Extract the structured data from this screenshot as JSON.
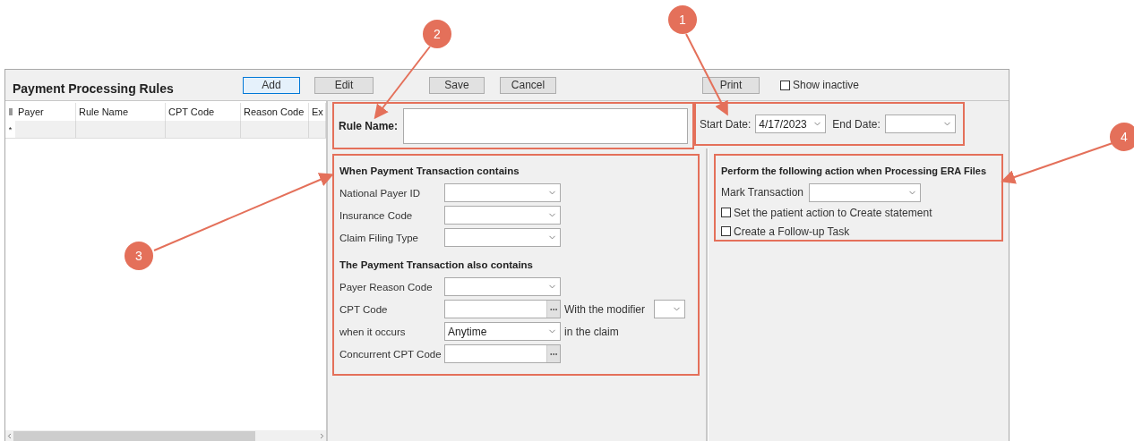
{
  "window": {
    "title": "Payment Processing Rules"
  },
  "toolbar": {
    "buttons": [
      {
        "label": "Add",
        "focused": true
      },
      {
        "label": "Edit",
        "focused": false
      },
      {
        "label": "Save",
        "focused": false
      },
      {
        "label": "Cancel",
        "focused": false
      },
      {
        "label": "Print",
        "focused": false
      }
    ],
    "show_inactive": {
      "label": "Show inactive",
      "checked": false
    }
  },
  "grid": {
    "columns": [
      "Payer",
      "Rule Name",
      "CPT Code",
      "Reason Code",
      "Ex"
    ],
    "new_row_marker": "*"
  },
  "rule": {
    "label": "Rule Name:"
  },
  "dates": {
    "start_label": "Start Date:",
    "start_value": "4/17/2023",
    "end_label": "End Date:"
  },
  "conditions": {
    "groups": [
      {
        "title": "When Payment Transaction contains",
        "rows": [
          [
            {
              "kind": "label",
              "text": "National Payer ID"
            },
            {
              "kind": "combo"
            }
          ],
          [
            {
              "kind": "label",
              "text": "Insurance Code"
            },
            {
              "kind": "combo"
            }
          ],
          [
            {
              "kind": "label",
              "text": "Claim Filing Type"
            },
            {
              "kind": "combo"
            }
          ]
        ]
      },
      {
        "title": "The Payment Transaction also contains",
        "rows": [
          [
            {
              "kind": "label",
              "text": "Payer Reason Code"
            },
            {
              "kind": "combo"
            }
          ],
          [
            {
              "kind": "label",
              "text": "CPT Code"
            },
            {
              "kind": "lookup"
            },
            {
              "kind": "note",
              "text": "With the modifier"
            },
            {
              "kind": "small_combo"
            }
          ],
          [
            {
              "kind": "label",
              "text": "when it occurs"
            },
            {
              "kind": "combo",
              "value": "Anytime"
            },
            {
              "kind": "note",
              "text": "in the claim"
            }
          ],
          [
            {
              "kind": "label",
              "text": "Concurrent CPT Code"
            },
            {
              "kind": "lookup"
            }
          ]
        ]
      }
    ]
  },
  "action": {
    "title": "Perform the following action when Processing ERA Files",
    "mark_label": "Mark Transaction",
    "checkboxes": [
      {
        "label": "Set the patient action to Create statement",
        "checked": false
      },
      {
        "label": "Create a Follow-up Task",
        "checked": false
      }
    ]
  },
  "annotations": [
    {
      "number": "1"
    },
    {
      "number": "2"
    },
    {
      "number": "3"
    },
    {
      "number": "4"
    }
  ]
}
